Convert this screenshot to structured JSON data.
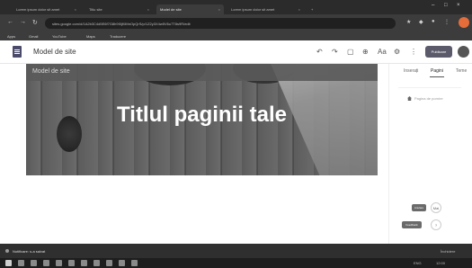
{
  "browser": {
    "tabs": [
      {
        "label": "Lorem ipsum dolor sit amet",
        "active": false
      },
      {
        "label": "Titlu site",
        "active": false
      },
      {
        "label": "Model de site",
        "active": true
      },
      {
        "label": "Lorem ipsum dolor sit amet",
        "active": false
      }
    ],
    "new_tab_label": "+",
    "url": "sites.google.com/d/1A2b3C4d5E6f7G8h9I0jKlMnOpQrS/p/1Z2y3X4w5V6u7T8s9R/edit",
    "bookmarks": [
      "Apps",
      "Gmail",
      "YouTube",
      "Maps",
      "Traducere"
    ]
  },
  "editor": {
    "site_name": "Model de site",
    "publish_label": "Publicare",
    "toolbar": {
      "undo": "↶",
      "redo": "↷",
      "preview": "▢",
      "link": "⊕",
      "theme": "Aa",
      "settings": "⚙",
      "more": "⋮"
    }
  },
  "canvas": {
    "header_label": "Model de site",
    "page_title": "Titlul paginii tale"
  },
  "panel": {
    "tabs": [
      "Inserați",
      "Pagini",
      "Teme"
    ],
    "active_tab": "Pagini",
    "page_item": "Pagina de pornire"
  },
  "floating": {
    "button1_label": "Anulare",
    "circle1_label": "Mai",
    "button2_label": "Feedback",
    "circle2_label": "?"
  },
  "notification": {
    "text": "Notificare: s-a salvat",
    "right": "Închidere"
  },
  "taskbar": {
    "tray_lang": "ENG",
    "tray_time": "12:00"
  },
  "colors": {
    "browser_chrome": "#3c3c3c",
    "publish_button": "#5a5a6a",
    "banner_overlay": "#5a5a5a"
  }
}
